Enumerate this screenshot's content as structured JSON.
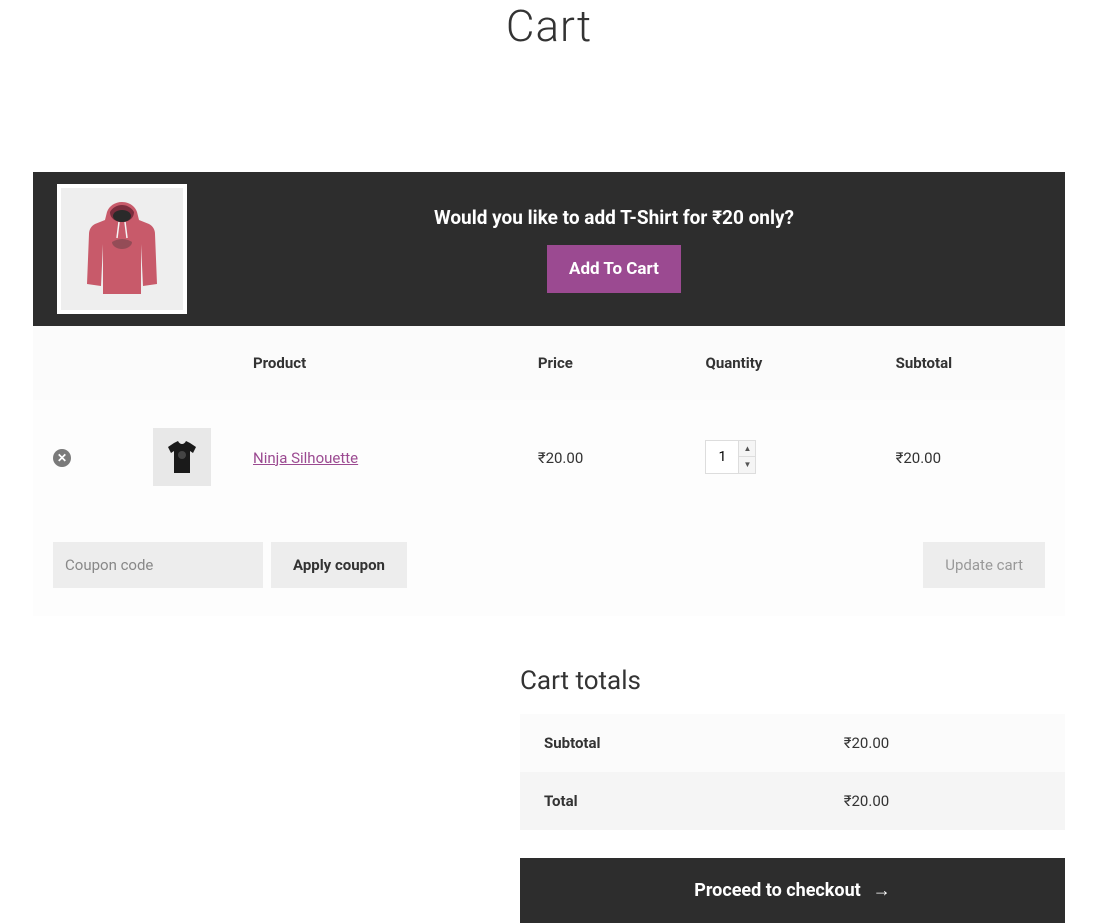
{
  "page": {
    "title": "Cart"
  },
  "upsell": {
    "message": "Would you like to add T-Shirt for ₹20 only?",
    "button_label": "Add To Cart"
  },
  "table": {
    "headers": {
      "product": "Product",
      "price": "Price",
      "quantity": "Quantity",
      "subtotal": "Subtotal"
    },
    "items": [
      {
        "name": "Ninja Silhouette",
        "price": "₹20.00",
        "quantity": "1",
        "subtotal": "₹20.00"
      }
    ]
  },
  "actions": {
    "coupon_placeholder": "Coupon code",
    "apply_coupon_label": "Apply coupon",
    "update_cart_label": "Update cart"
  },
  "totals": {
    "title": "Cart totals",
    "subtotal_label": "Subtotal",
    "subtotal_value": "₹20.00",
    "total_label": "Total",
    "total_value": "₹20.00",
    "checkout_label": "Proceed to checkout"
  }
}
